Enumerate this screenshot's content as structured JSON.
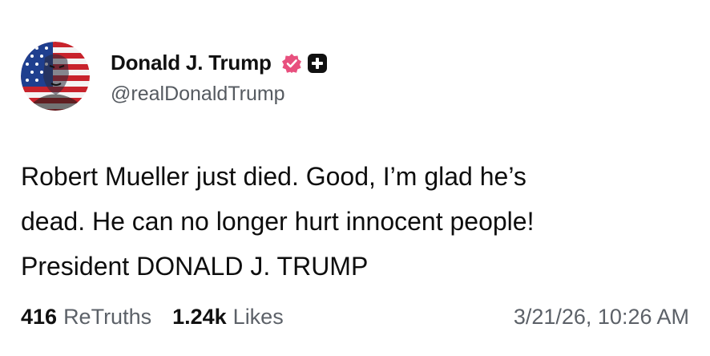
{
  "author": {
    "display_name": "Donald J. Trump",
    "handle": "@realDonaldTrump",
    "avatar_icon": "flag-portrait-avatar",
    "verified_icon": "verified-badge-icon",
    "verified_color": "#e8507e",
    "extra_badge_icon": "plus-badge-icon"
  },
  "post": {
    "text": "Robert Mueller just died. Good, I’m glad he’s\ndead. He can no longer hurt innocent people!\nPresident DONALD J. TRUMP"
  },
  "stats": {
    "retruths_count": "416",
    "retruths_label": "ReTruths",
    "likes_count": "1.24k",
    "likes_label": "Likes"
  },
  "timestamp": "3/21/26, 10:26 AM"
}
